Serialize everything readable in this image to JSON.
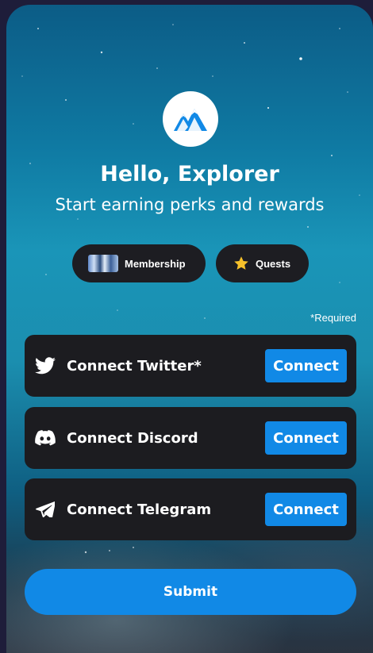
{
  "header": {
    "logo_icon": "mountain-icon",
    "title": "Hello, Explorer",
    "subtitle": "Start earning perks and rewards"
  },
  "chips": [
    {
      "label": "Membership",
      "icon": "membership-thumbnail"
    },
    {
      "label": "Quests",
      "icon": "star-icon"
    }
  ],
  "required_note": "*Required",
  "connections": [
    {
      "label": "Connect Twitter*",
      "icon": "twitter-icon",
      "button": "Connect"
    },
    {
      "label": "Connect Discord",
      "icon": "discord-icon",
      "button": "Connect"
    },
    {
      "label": "Connect Telegram",
      "icon": "telegram-icon",
      "button": "Connect"
    }
  ],
  "submit_label": "Submit",
  "colors": {
    "accent": "#1189e6",
    "row_background": "#1c1c20",
    "page_background": "#1e1d3a",
    "star": "#f7c12b"
  }
}
